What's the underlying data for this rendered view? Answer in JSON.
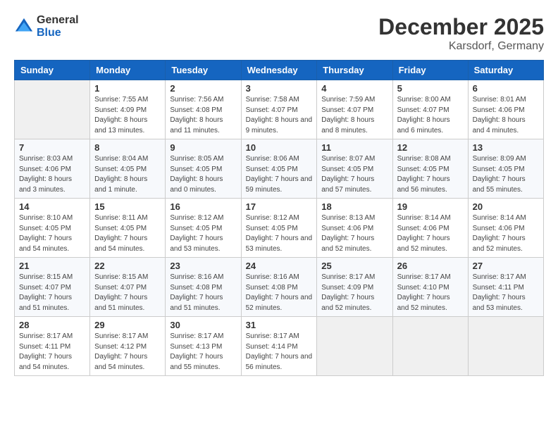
{
  "logo": {
    "general": "General",
    "blue": "Blue"
  },
  "title": {
    "month": "December 2025",
    "location": "Karsdorf, Germany"
  },
  "header_days": [
    "Sunday",
    "Monday",
    "Tuesday",
    "Wednesday",
    "Thursday",
    "Friday",
    "Saturday"
  ],
  "weeks": [
    [
      {
        "day": "",
        "sunrise": "",
        "sunset": "",
        "daylight": ""
      },
      {
        "day": "1",
        "sunrise": "Sunrise: 7:55 AM",
        "sunset": "Sunset: 4:09 PM",
        "daylight": "Daylight: 8 hours and 13 minutes."
      },
      {
        "day": "2",
        "sunrise": "Sunrise: 7:56 AM",
        "sunset": "Sunset: 4:08 PM",
        "daylight": "Daylight: 8 hours and 11 minutes."
      },
      {
        "day": "3",
        "sunrise": "Sunrise: 7:58 AM",
        "sunset": "Sunset: 4:07 PM",
        "daylight": "Daylight: 8 hours and 9 minutes."
      },
      {
        "day": "4",
        "sunrise": "Sunrise: 7:59 AM",
        "sunset": "Sunset: 4:07 PM",
        "daylight": "Daylight: 8 hours and 8 minutes."
      },
      {
        "day": "5",
        "sunrise": "Sunrise: 8:00 AM",
        "sunset": "Sunset: 4:07 PM",
        "daylight": "Daylight: 8 hours and 6 minutes."
      },
      {
        "day": "6",
        "sunrise": "Sunrise: 8:01 AM",
        "sunset": "Sunset: 4:06 PM",
        "daylight": "Daylight: 8 hours and 4 minutes."
      }
    ],
    [
      {
        "day": "7",
        "sunrise": "Sunrise: 8:03 AM",
        "sunset": "Sunset: 4:06 PM",
        "daylight": "Daylight: 8 hours and 3 minutes."
      },
      {
        "day": "8",
        "sunrise": "Sunrise: 8:04 AM",
        "sunset": "Sunset: 4:05 PM",
        "daylight": "Daylight: 8 hours and 1 minute."
      },
      {
        "day": "9",
        "sunrise": "Sunrise: 8:05 AM",
        "sunset": "Sunset: 4:05 PM",
        "daylight": "Daylight: 8 hours and 0 minutes."
      },
      {
        "day": "10",
        "sunrise": "Sunrise: 8:06 AM",
        "sunset": "Sunset: 4:05 PM",
        "daylight": "Daylight: 7 hours and 59 minutes."
      },
      {
        "day": "11",
        "sunrise": "Sunrise: 8:07 AM",
        "sunset": "Sunset: 4:05 PM",
        "daylight": "Daylight: 7 hours and 57 minutes."
      },
      {
        "day": "12",
        "sunrise": "Sunrise: 8:08 AM",
        "sunset": "Sunset: 4:05 PM",
        "daylight": "Daylight: 7 hours and 56 minutes."
      },
      {
        "day": "13",
        "sunrise": "Sunrise: 8:09 AM",
        "sunset": "Sunset: 4:05 PM",
        "daylight": "Daylight: 7 hours and 55 minutes."
      }
    ],
    [
      {
        "day": "14",
        "sunrise": "Sunrise: 8:10 AM",
        "sunset": "Sunset: 4:05 PM",
        "daylight": "Daylight: 7 hours and 54 minutes."
      },
      {
        "day": "15",
        "sunrise": "Sunrise: 8:11 AM",
        "sunset": "Sunset: 4:05 PM",
        "daylight": "Daylight: 7 hours and 54 minutes."
      },
      {
        "day": "16",
        "sunrise": "Sunrise: 8:12 AM",
        "sunset": "Sunset: 4:05 PM",
        "daylight": "Daylight: 7 hours and 53 minutes."
      },
      {
        "day": "17",
        "sunrise": "Sunrise: 8:12 AM",
        "sunset": "Sunset: 4:05 PM",
        "daylight": "Daylight: 7 hours and 53 minutes."
      },
      {
        "day": "18",
        "sunrise": "Sunrise: 8:13 AM",
        "sunset": "Sunset: 4:06 PM",
        "daylight": "Daylight: 7 hours and 52 minutes."
      },
      {
        "day": "19",
        "sunrise": "Sunrise: 8:14 AM",
        "sunset": "Sunset: 4:06 PM",
        "daylight": "Daylight: 7 hours and 52 minutes."
      },
      {
        "day": "20",
        "sunrise": "Sunrise: 8:14 AM",
        "sunset": "Sunset: 4:06 PM",
        "daylight": "Daylight: 7 hours and 52 minutes."
      }
    ],
    [
      {
        "day": "21",
        "sunrise": "Sunrise: 8:15 AM",
        "sunset": "Sunset: 4:07 PM",
        "daylight": "Daylight: 7 hours and 51 minutes."
      },
      {
        "day": "22",
        "sunrise": "Sunrise: 8:15 AM",
        "sunset": "Sunset: 4:07 PM",
        "daylight": "Daylight: 7 hours and 51 minutes."
      },
      {
        "day": "23",
        "sunrise": "Sunrise: 8:16 AM",
        "sunset": "Sunset: 4:08 PM",
        "daylight": "Daylight: 7 hours and 51 minutes."
      },
      {
        "day": "24",
        "sunrise": "Sunrise: 8:16 AM",
        "sunset": "Sunset: 4:08 PM",
        "daylight": "Daylight: 7 hours and 52 minutes."
      },
      {
        "day": "25",
        "sunrise": "Sunrise: 8:17 AM",
        "sunset": "Sunset: 4:09 PM",
        "daylight": "Daylight: 7 hours and 52 minutes."
      },
      {
        "day": "26",
        "sunrise": "Sunrise: 8:17 AM",
        "sunset": "Sunset: 4:10 PM",
        "daylight": "Daylight: 7 hours and 52 minutes."
      },
      {
        "day": "27",
        "sunrise": "Sunrise: 8:17 AM",
        "sunset": "Sunset: 4:11 PM",
        "daylight": "Daylight: 7 hours and 53 minutes."
      }
    ],
    [
      {
        "day": "28",
        "sunrise": "Sunrise: 8:17 AM",
        "sunset": "Sunset: 4:11 PM",
        "daylight": "Daylight: 7 hours and 54 minutes."
      },
      {
        "day": "29",
        "sunrise": "Sunrise: 8:17 AM",
        "sunset": "Sunset: 4:12 PM",
        "daylight": "Daylight: 7 hours and 54 minutes."
      },
      {
        "day": "30",
        "sunrise": "Sunrise: 8:17 AM",
        "sunset": "Sunset: 4:13 PM",
        "daylight": "Daylight: 7 hours and 55 minutes."
      },
      {
        "day": "31",
        "sunrise": "Sunrise: 8:17 AM",
        "sunset": "Sunset: 4:14 PM",
        "daylight": "Daylight: 7 hours and 56 minutes."
      },
      {
        "day": "",
        "sunrise": "",
        "sunset": "",
        "daylight": ""
      },
      {
        "day": "",
        "sunrise": "",
        "sunset": "",
        "daylight": ""
      },
      {
        "day": "",
        "sunrise": "",
        "sunset": "",
        "daylight": ""
      }
    ]
  ]
}
